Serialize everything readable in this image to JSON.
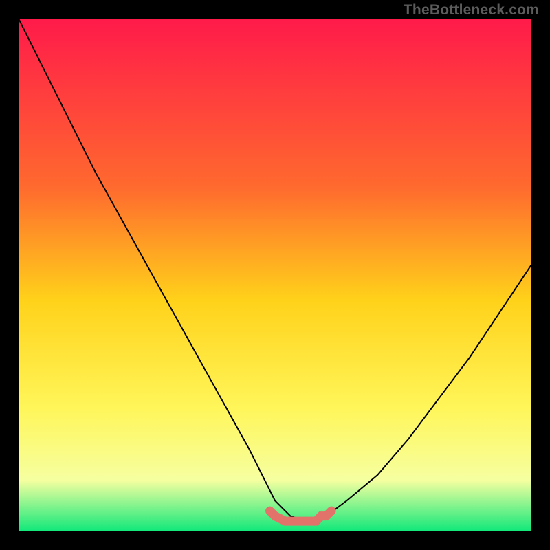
{
  "watermark": "TheBottleneck.com",
  "colors": {
    "frame": "#000000",
    "gradient_top": "#ff1a4a",
    "gradient_mid_upper": "#ff6a2e",
    "gradient_mid": "#ffd21a",
    "gradient_mid_lower": "#fff65a",
    "gradient_lower": "#f6ffa0",
    "gradient_bottom": "#10e87a",
    "curve": "#000000",
    "accent_band": "#e2736a"
  },
  "chart_data": {
    "type": "line",
    "title": "",
    "xlabel": "",
    "ylabel": "",
    "xlim": [
      0,
      100
    ],
    "ylim": [
      0,
      100
    ],
    "series": [
      {
        "name": "bottleneck-curve",
        "x": [
          0,
          5,
          10,
          15,
          20,
          25,
          30,
          35,
          40,
          45,
          48,
          50,
          53,
          56,
          58,
          60,
          64,
          70,
          76,
          82,
          88,
          94,
          100
        ],
        "y": [
          100,
          90,
          80,
          70,
          61,
          52,
          43,
          34,
          25,
          16,
          10,
          6,
          3,
          2,
          2,
          3,
          6,
          11,
          18,
          26,
          34,
          43,
          52
        ]
      }
    ],
    "accent_segment": {
      "name": "bottom-highlight",
      "x": [
        49,
        50,
        52,
        54,
        56,
        58,
        59,
        60,
        61
      ],
      "y": [
        4,
        3,
        2,
        2,
        2,
        2,
        3,
        3,
        4
      ]
    }
  }
}
